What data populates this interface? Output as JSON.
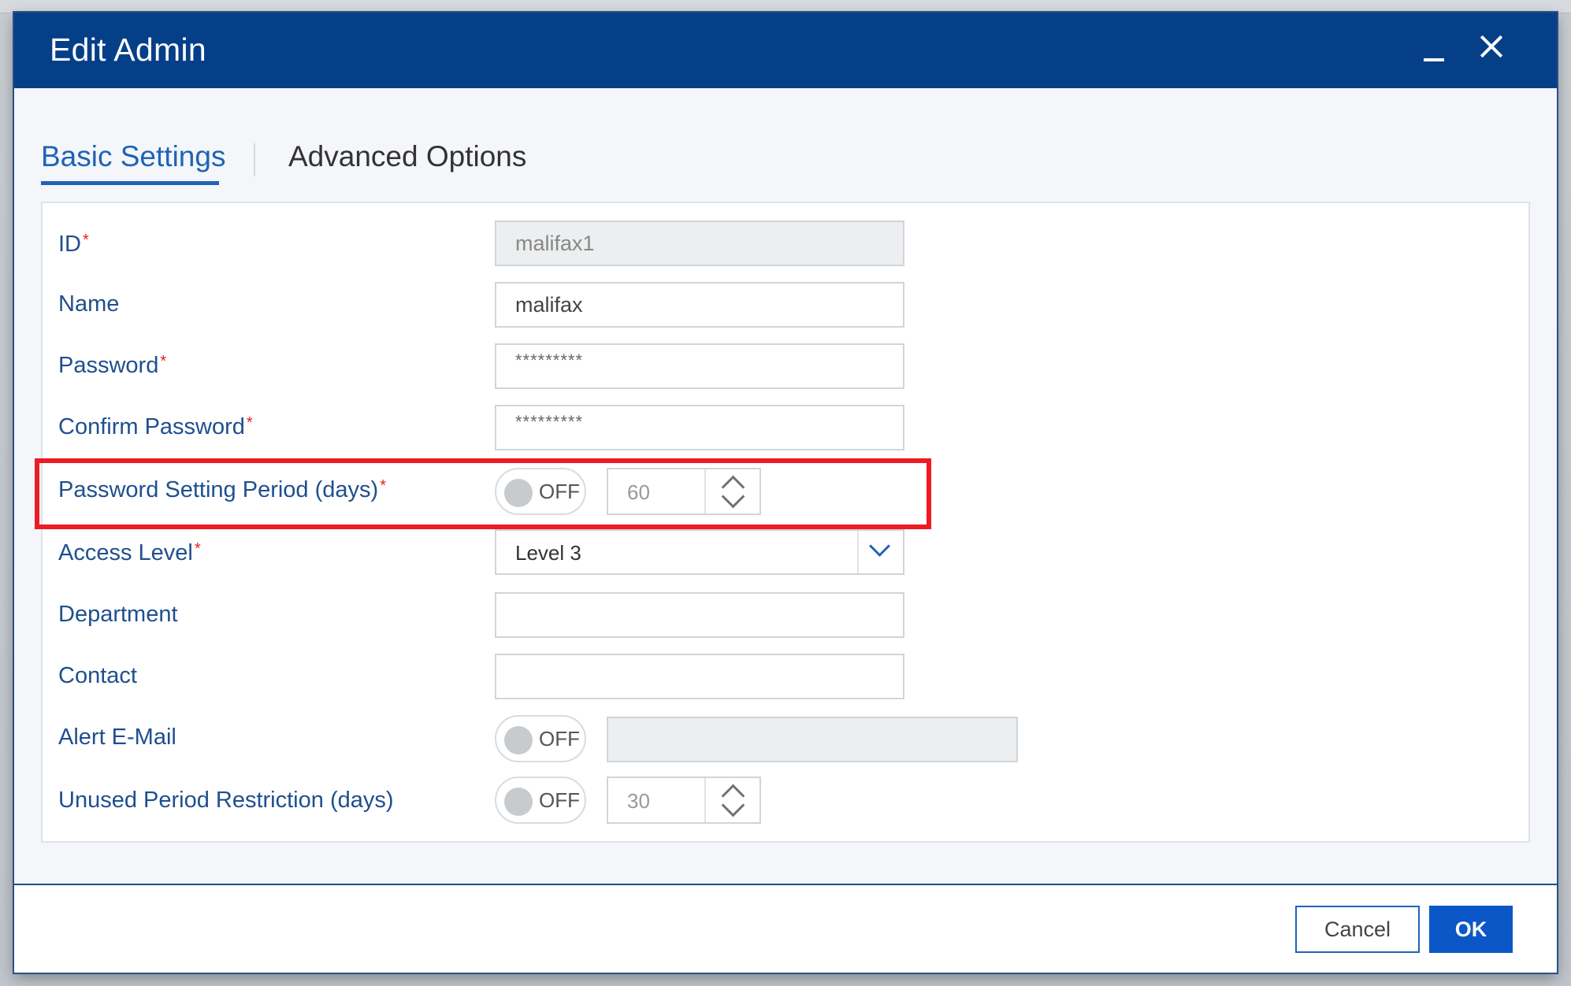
{
  "dialog": {
    "title": "Edit Admin"
  },
  "tabs": [
    {
      "label": "Basic Settings",
      "active": true
    },
    {
      "label": "Advanced Options",
      "active": false
    }
  ],
  "form": {
    "id": {
      "label": "ID",
      "required_mark": "*",
      "value": "malifax1"
    },
    "name": {
      "label": "Name",
      "value": "malifax"
    },
    "password": {
      "label": "Password",
      "required_mark": "*",
      "value": "*********"
    },
    "confirm_password": {
      "label": "Confirm Password",
      "required_mark": "*",
      "value": "*********"
    },
    "password_setting_period": {
      "label": "Password Setting Period (days)",
      "required_mark": "*",
      "toggle_text": "OFF",
      "value": "60"
    },
    "access_level": {
      "label": "Access Level",
      "required_mark": "*",
      "selected": "Level 3"
    },
    "department": {
      "label": "Department",
      "value": ""
    },
    "contact": {
      "label": "Contact",
      "value": ""
    },
    "alert_email": {
      "label": "Alert E-Mail",
      "toggle_text": "OFF",
      "value": ""
    },
    "unused_period_restriction": {
      "label": "Unused Period Restriction (days)",
      "toggle_text": "OFF",
      "value": "30"
    }
  },
  "buttons": {
    "cancel": "Cancel",
    "ok": "OK"
  },
  "colors": {
    "titlebar": "#053f88",
    "accent": "#1f63b8",
    "highlight": "#ec1b24",
    "ok_button": "#0b57c7"
  },
  "icons": {
    "minimize": "minimize-icon",
    "close": "close-icon",
    "select_arrow": "chevron-down-icon",
    "stepper_up": "chevron-up-icon",
    "stepper_down": "chevron-down-icon"
  }
}
